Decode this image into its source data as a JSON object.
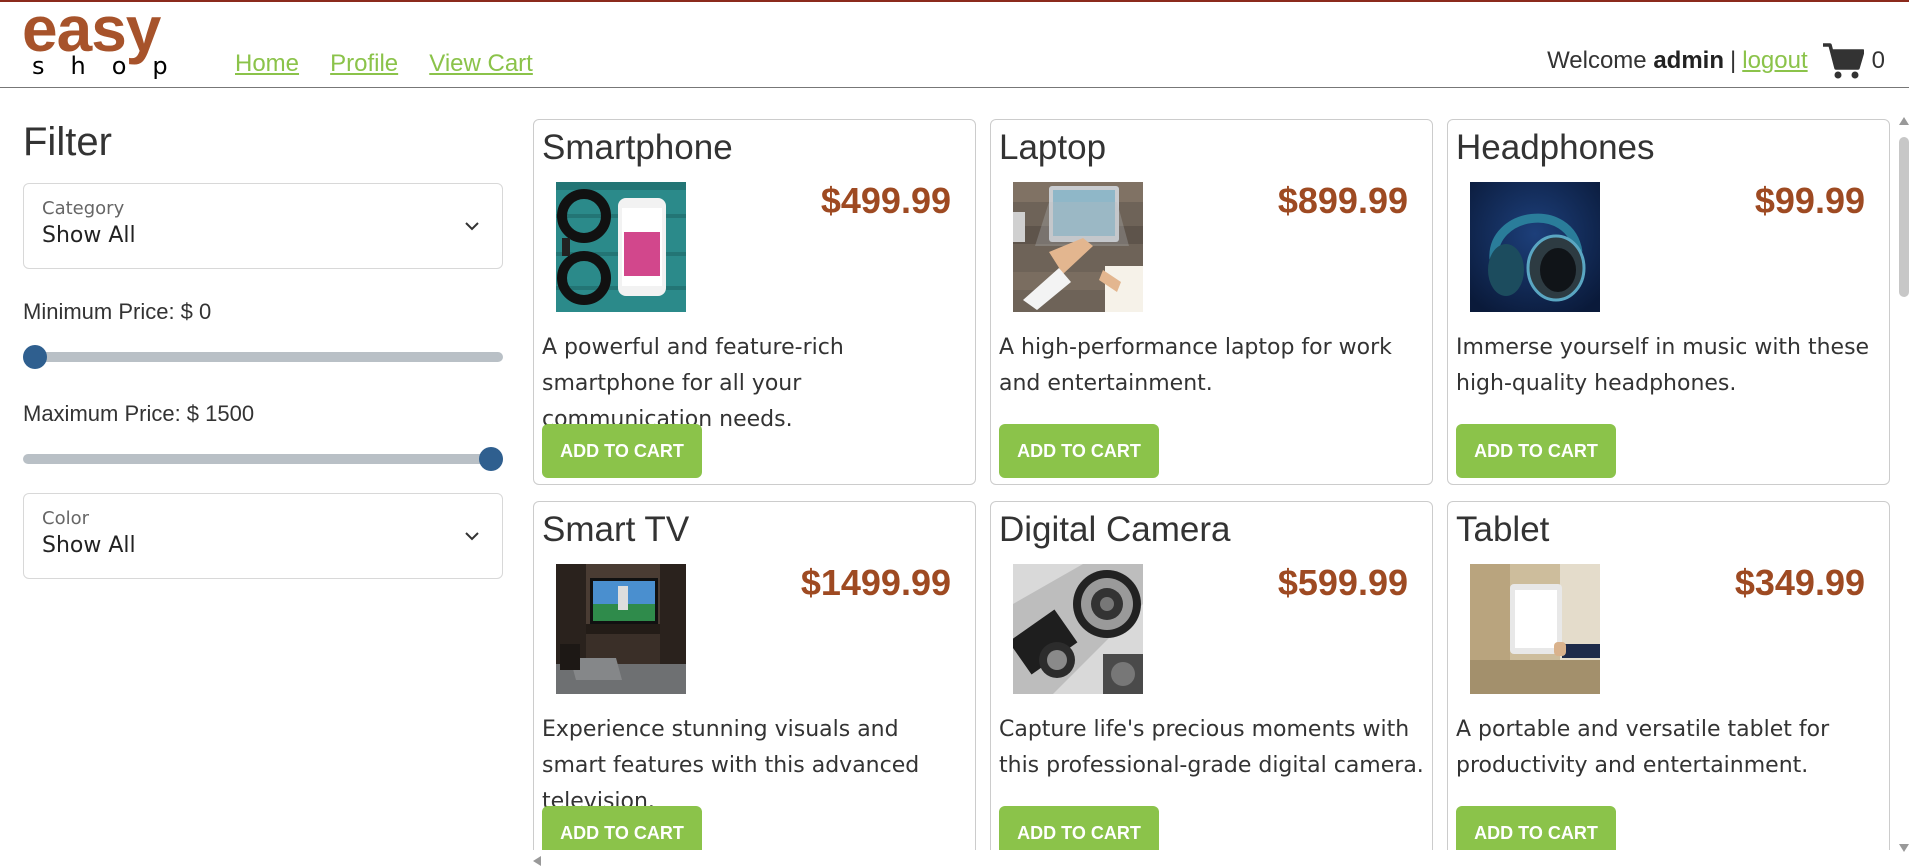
{
  "brand": {
    "word1": "easy",
    "word2": "shop"
  },
  "nav": [
    {
      "label": "Home"
    },
    {
      "label": "Profile"
    },
    {
      "label": "View Cart"
    }
  ],
  "user": {
    "welcome": "Welcome",
    "name": "admin",
    "separator": "|",
    "logout": "logout",
    "cart_count": "0"
  },
  "filter": {
    "title": "Filter",
    "category": {
      "label": "Category",
      "value": "Show All"
    },
    "min_price": {
      "label": "Minimum Price: $ 0",
      "value": 0
    },
    "max_price": {
      "label": "Maximum Price: $ 1500",
      "value": 1500
    },
    "slider_range": [
      0,
      1500
    ],
    "color": {
      "label": "Color",
      "value": "Show All"
    }
  },
  "add_to_cart_label": "ADD TO CART",
  "products": [
    {
      "name": "Smartphone",
      "price": "$499.99",
      "description": "A powerful and feature-rich smartphone for all your communication needs.",
      "image": "smartphone-photo"
    },
    {
      "name": "Laptop",
      "price": "$899.99",
      "description": "A high-performance laptop for work and entertainment.",
      "image": "laptop-photo"
    },
    {
      "name": "Headphones",
      "price": "$99.99",
      "description": "Immerse yourself in music with these high-quality headphones.",
      "image": "headphones-photo"
    },
    {
      "name": "Smart TV",
      "price": "$1499.99",
      "description": "Experience stunning visuals and smart features with this advanced television.",
      "image": "tv-photo"
    },
    {
      "name": "Digital Camera",
      "price": "$599.99",
      "description": "Capture life's precious moments with this professional-grade digital camera.",
      "image": "camera-photo"
    },
    {
      "name": "Tablet",
      "price": "$349.99",
      "description": "A portable and versatile tablet for productivity and entertainment.",
      "image": "tablet-photo"
    }
  ],
  "colors": {
    "brand": "#a7532b",
    "price": "#9e4a22",
    "accent": "#8bc34a",
    "slider_thumb": "#2f5f8f"
  }
}
